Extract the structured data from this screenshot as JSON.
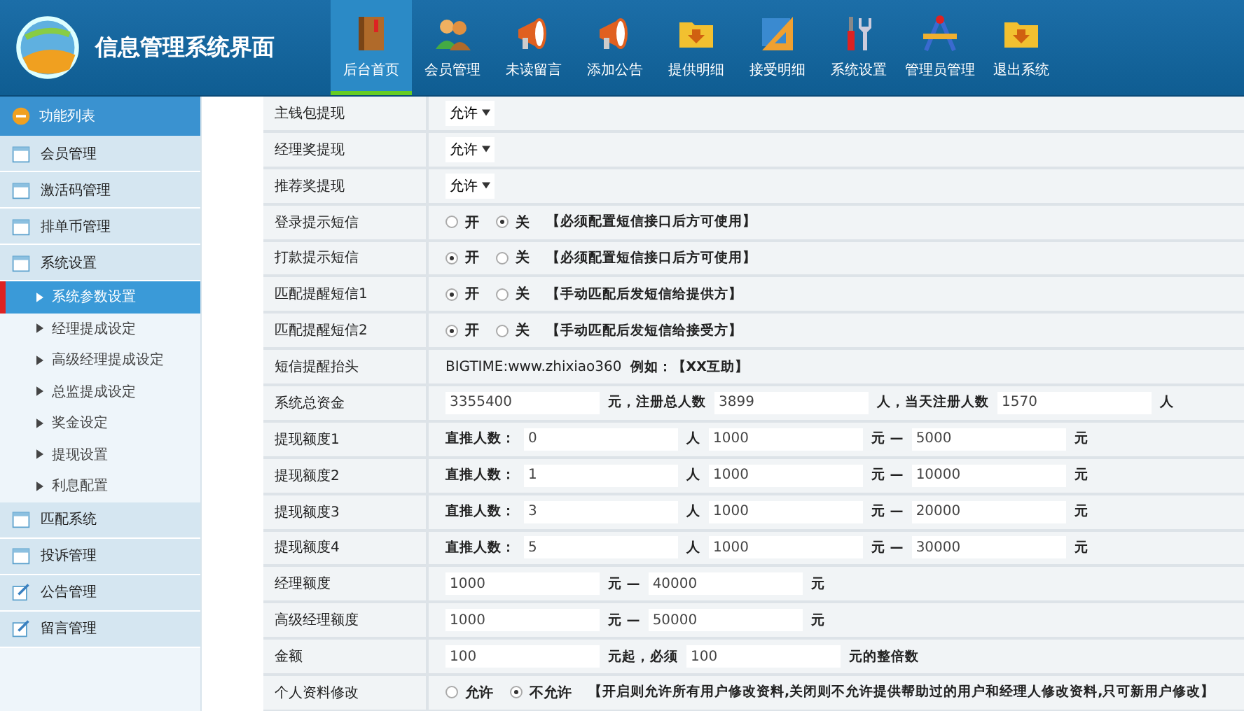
{
  "header": {
    "title": "信息管理系统界面"
  },
  "nav": [
    {
      "label": "后台首页",
      "kind": "book",
      "selected": true
    },
    {
      "label": "会员管理",
      "kind": "people",
      "selected": false
    },
    {
      "label": "未读留言",
      "kind": "megaphone",
      "selected": false
    },
    {
      "label": "添加公告",
      "kind": "megaphone",
      "selected": false
    },
    {
      "label": "提供明细",
      "kind": "folder",
      "selected": false
    },
    {
      "label": "接受明细",
      "kind": "ruler",
      "selected": false
    },
    {
      "label": "系统设置",
      "kind": "tools",
      "selected": false
    },
    {
      "label": "管理员管理",
      "kind": "compass",
      "selected": false
    },
    {
      "label": "退出系统",
      "kind": "folder",
      "selected": false
    }
  ],
  "sidebar": {
    "title": "功能列表",
    "items": [
      {
        "label": "会员管理",
        "kind": "calendar"
      },
      {
        "label": "激活码管理",
        "kind": "calendar"
      },
      {
        "label": "排单币管理",
        "kind": "calendar"
      },
      {
        "label": "系统设置",
        "kind": "calendar",
        "children": [
          {
            "label": "系统参数设置",
            "selected": true
          },
          {
            "label": "经理提成设定",
            "selected": false
          },
          {
            "label": "高级经理提成设定",
            "selected": false
          },
          {
            "label": "总监提成设定",
            "selected": false
          },
          {
            "label": "奖金设定",
            "selected": false
          },
          {
            "label": "提现设置",
            "selected": false
          },
          {
            "label": "利息配置",
            "selected": false
          }
        ]
      },
      {
        "label": "匹配系统",
        "kind": "calendar"
      },
      {
        "label": "投诉管理",
        "kind": "calendar"
      },
      {
        "label": "公告管理",
        "kind": "edit"
      },
      {
        "label": "留言管理",
        "kind": "edit"
      }
    ]
  },
  "settings": [
    {
      "label": "主钱包提现",
      "parts": [
        {
          "kind": "select",
          "value": "允许"
        }
      ]
    },
    {
      "label": "经理奖提现",
      "parts": [
        {
          "kind": "select",
          "value": "允许"
        }
      ]
    },
    {
      "label": "推荐奖提现",
      "parts": [
        {
          "kind": "select",
          "value": "允许"
        }
      ]
    },
    {
      "label": "登录提示短信",
      "parts": [
        {
          "kind": "radio",
          "text": "开",
          "selected": false
        },
        {
          "kind": "radio",
          "text": "关",
          "selected": true
        },
        {
          "kind": "note",
          "text": "【必须配置短信接口后方可使用】"
        }
      ]
    },
    {
      "label": "打款提示短信",
      "parts": [
        {
          "kind": "radio",
          "text": "开",
          "selected": true
        },
        {
          "kind": "radio",
          "text": "关",
          "selected": false
        },
        {
          "kind": "note",
          "text": "【必须配置短信接口后方可使用】"
        }
      ]
    },
    {
      "label": "匹配提醒短信1",
      "parts": [
        {
          "kind": "radio",
          "text": "开",
          "selected": true
        },
        {
          "kind": "radio",
          "text": "关",
          "selected": false
        },
        {
          "kind": "note",
          "text": "【手动匹配后发短信给提供方】"
        }
      ]
    },
    {
      "label": "匹配提醒短信2",
      "parts": [
        {
          "kind": "radio",
          "text": "开",
          "selected": true
        },
        {
          "kind": "radio",
          "text": "关",
          "selected": false
        },
        {
          "kind": "note",
          "text": "【手动匹配后发短信给接受方】"
        }
      ]
    },
    {
      "label": "短信提醒抬头",
      "parts": [
        {
          "kind": "plain",
          "text": "BIGTIME:www.zhixiao360"
        },
        {
          "kind": "note",
          "text": "例如：【XX互助】"
        }
      ]
    },
    {
      "label": "系统总资金",
      "parts": [
        {
          "kind": "input",
          "value": "3355400"
        },
        {
          "kind": "note",
          "text": "元，注册总人数"
        },
        {
          "kind": "input",
          "value": "3899"
        },
        {
          "kind": "note",
          "text": "人，当天注册人数"
        },
        {
          "kind": "input",
          "value": "1570"
        },
        {
          "kind": "note",
          "text": "人"
        }
      ]
    },
    {
      "label": "提现额度1",
      "parts": [
        {
          "kind": "note",
          "text": "直推人数："
        },
        {
          "kind": "input",
          "value": "0"
        },
        {
          "kind": "note",
          "text": "人"
        },
        {
          "kind": "input",
          "value": "1000"
        },
        {
          "kind": "note",
          "text": "元 —"
        },
        {
          "kind": "input",
          "value": "5000"
        },
        {
          "kind": "note",
          "text": "元"
        }
      ]
    },
    {
      "label": "提现额度2",
      "parts": [
        {
          "kind": "note",
          "text": "直推人数："
        },
        {
          "kind": "input",
          "value": "1"
        },
        {
          "kind": "note",
          "text": "人"
        },
        {
          "kind": "input",
          "value": "1000"
        },
        {
          "kind": "note",
          "text": "元 —"
        },
        {
          "kind": "input",
          "value": "10000"
        },
        {
          "kind": "note",
          "text": "元"
        }
      ]
    },
    {
      "label": "提现额度3",
      "parts": [
        {
          "kind": "note",
          "text": "直推人数："
        },
        {
          "kind": "input",
          "value": "3"
        },
        {
          "kind": "note",
          "text": "人"
        },
        {
          "kind": "input",
          "value": "1000"
        },
        {
          "kind": "note",
          "text": "元 —"
        },
        {
          "kind": "input",
          "value": "20000"
        },
        {
          "kind": "note",
          "text": "元"
        }
      ]
    },
    {
      "label": "提现额度4",
      "parts": [
        {
          "kind": "note",
          "text": "直推人数："
        },
        {
          "kind": "input",
          "value": "5"
        },
        {
          "kind": "note",
          "text": "人"
        },
        {
          "kind": "input",
          "value": "1000"
        },
        {
          "kind": "note",
          "text": "元 —"
        },
        {
          "kind": "input",
          "value": "30000"
        },
        {
          "kind": "note",
          "text": "元"
        }
      ]
    },
    {
      "label": "经理额度",
      "parts": [
        {
          "kind": "input",
          "value": "1000"
        },
        {
          "kind": "note",
          "text": "元 —"
        },
        {
          "kind": "input",
          "value": "40000"
        },
        {
          "kind": "note",
          "text": "元"
        }
      ]
    },
    {
      "label": "高级经理额度",
      "parts": [
        {
          "kind": "input",
          "value": "1000"
        },
        {
          "kind": "note",
          "text": "元 —"
        },
        {
          "kind": "input",
          "value": "50000"
        },
        {
          "kind": "note",
          "text": "元"
        }
      ]
    },
    {
      "label": "金额",
      "parts": [
        {
          "kind": "input",
          "value": "100"
        },
        {
          "kind": "note",
          "text": "元起，必须"
        },
        {
          "kind": "input",
          "value": "100"
        },
        {
          "kind": "note",
          "text": "元的整倍数"
        }
      ]
    },
    {
      "label": "个人资料修改",
      "parts": [
        {
          "kind": "radio",
          "text": "允许",
          "selected": false
        },
        {
          "kind": "radio",
          "text": "不允许",
          "selected": true
        },
        {
          "kind": "note",
          "text": "【开启则允许所有用户修改资料,关闭则不允许提供帮助过的用户和经理人修改资料,只可新用户修改】"
        }
      ]
    }
  ]
}
